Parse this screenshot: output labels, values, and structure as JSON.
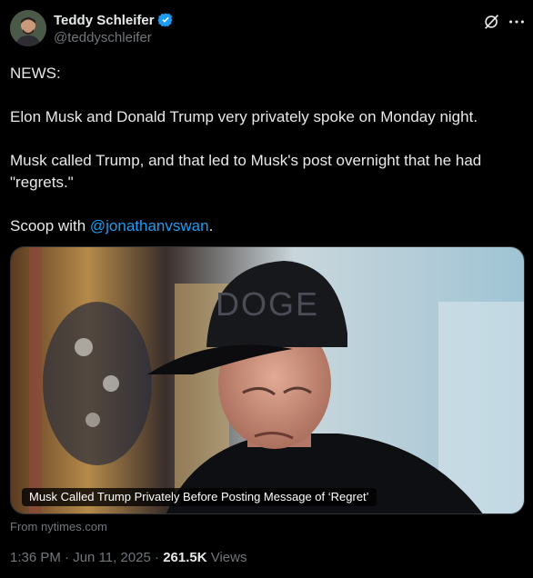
{
  "author": {
    "display_name": "Teddy Schleifer",
    "handle": "@teddyschleifer",
    "verified_icon": "verified-badge-icon"
  },
  "actions": {
    "grok_icon": "grok-icon",
    "more_icon": "more-dots-icon"
  },
  "tweet": {
    "line1": "NEWS:",
    "line2": "Elon Musk and Donald Trump very privately spoke on Monday night.",
    "line3a": "Musk called Trump, and that led to Musk's post overnight that he had",
    "line3b": "\"regrets.\"",
    "line4_prefix": "Scoop with ",
    "line4_mention": "@jonathanvswan",
    "line4_suffix": "."
  },
  "card": {
    "image_hat_text": "DOGE",
    "caption": "Musk Called Trump Privately Before Posting Message of ‘Regret’",
    "source": "From nytimes.com"
  },
  "meta": {
    "time": "1:36 PM",
    "sep1": " · ",
    "date": "Jun 11, 2025",
    "sep2": " · ",
    "views_count": "261.5K",
    "views_label": " Views"
  },
  "colors": {
    "background": "#000000",
    "text": "#e7e9ea",
    "secondary": "#71767b",
    "accent": "#1d9bf0"
  }
}
